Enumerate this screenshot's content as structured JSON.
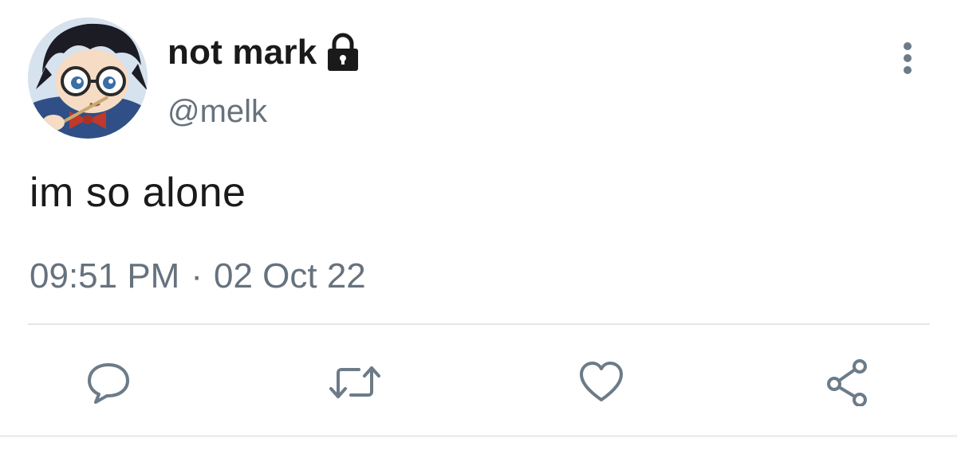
{
  "user": {
    "display_name": "not mark",
    "handle": "@melk",
    "protected_icon": "lock-icon"
  },
  "tweet": {
    "text": "im so alone",
    "time": "09:51 PM",
    "separator": "·",
    "date": "02 Oct 22"
  },
  "menu_icon": "more-vertical-icon",
  "actions": [
    {
      "name": "reply",
      "icon": "reply-icon"
    },
    {
      "name": "retweet",
      "icon": "retweet-icon"
    },
    {
      "name": "like",
      "icon": "heart-icon"
    },
    {
      "name": "share",
      "icon": "share-icon"
    }
  ],
  "colors": {
    "text": "#1a1a1a",
    "secondary": "#66727d",
    "divider": "#e3e6e9",
    "icon": "#6c7b88"
  }
}
